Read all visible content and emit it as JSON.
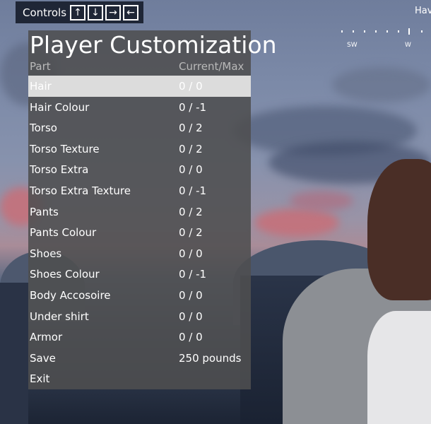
{
  "controls": {
    "label": "Controls",
    "keys": [
      "↑",
      "↓",
      "→",
      "←"
    ]
  },
  "compass": {
    "text": "Hav",
    "dir_left": "SW",
    "dir_right": "W"
  },
  "menu": {
    "title": "Player Customization",
    "col_part": "Part",
    "col_current_max": "Current/Max",
    "selected_index": 0,
    "rows": [
      {
        "name": "Hair",
        "value": "0 / 0"
      },
      {
        "name": "Hair Colour",
        "value": "0 / -1"
      },
      {
        "name": "Torso",
        "value": "0 / 2"
      },
      {
        "name": "Torso Texture",
        "value": "0 / 2"
      },
      {
        "name": "Torso Extra",
        "value": "0 / 0"
      },
      {
        "name": "Torso Extra Texture",
        "value": "0 / -1"
      },
      {
        "name": "Pants",
        "value": "0 / 2"
      },
      {
        "name": "Pants Colour",
        "value": "0 / 2"
      },
      {
        "name": "Shoes",
        "value": "0 / 0"
      },
      {
        "name": "Shoes Colour",
        "value": "0 / -1"
      },
      {
        "name": "Body Accosoire",
        "value": "0 / 0"
      },
      {
        "name": "Under shirt",
        "value": "0 / 0"
      },
      {
        "name": "Armor",
        "value": "0 / 0"
      },
      {
        "name": "Save",
        "value": "250 pounds"
      },
      {
        "name": "Exit",
        "value": ""
      }
    ]
  },
  "colors": {
    "panel_bg": "#4e4e50",
    "selected_row": "#dcdcdc",
    "text": "#ffffff",
    "header_text": "#b9b9b9"
  }
}
